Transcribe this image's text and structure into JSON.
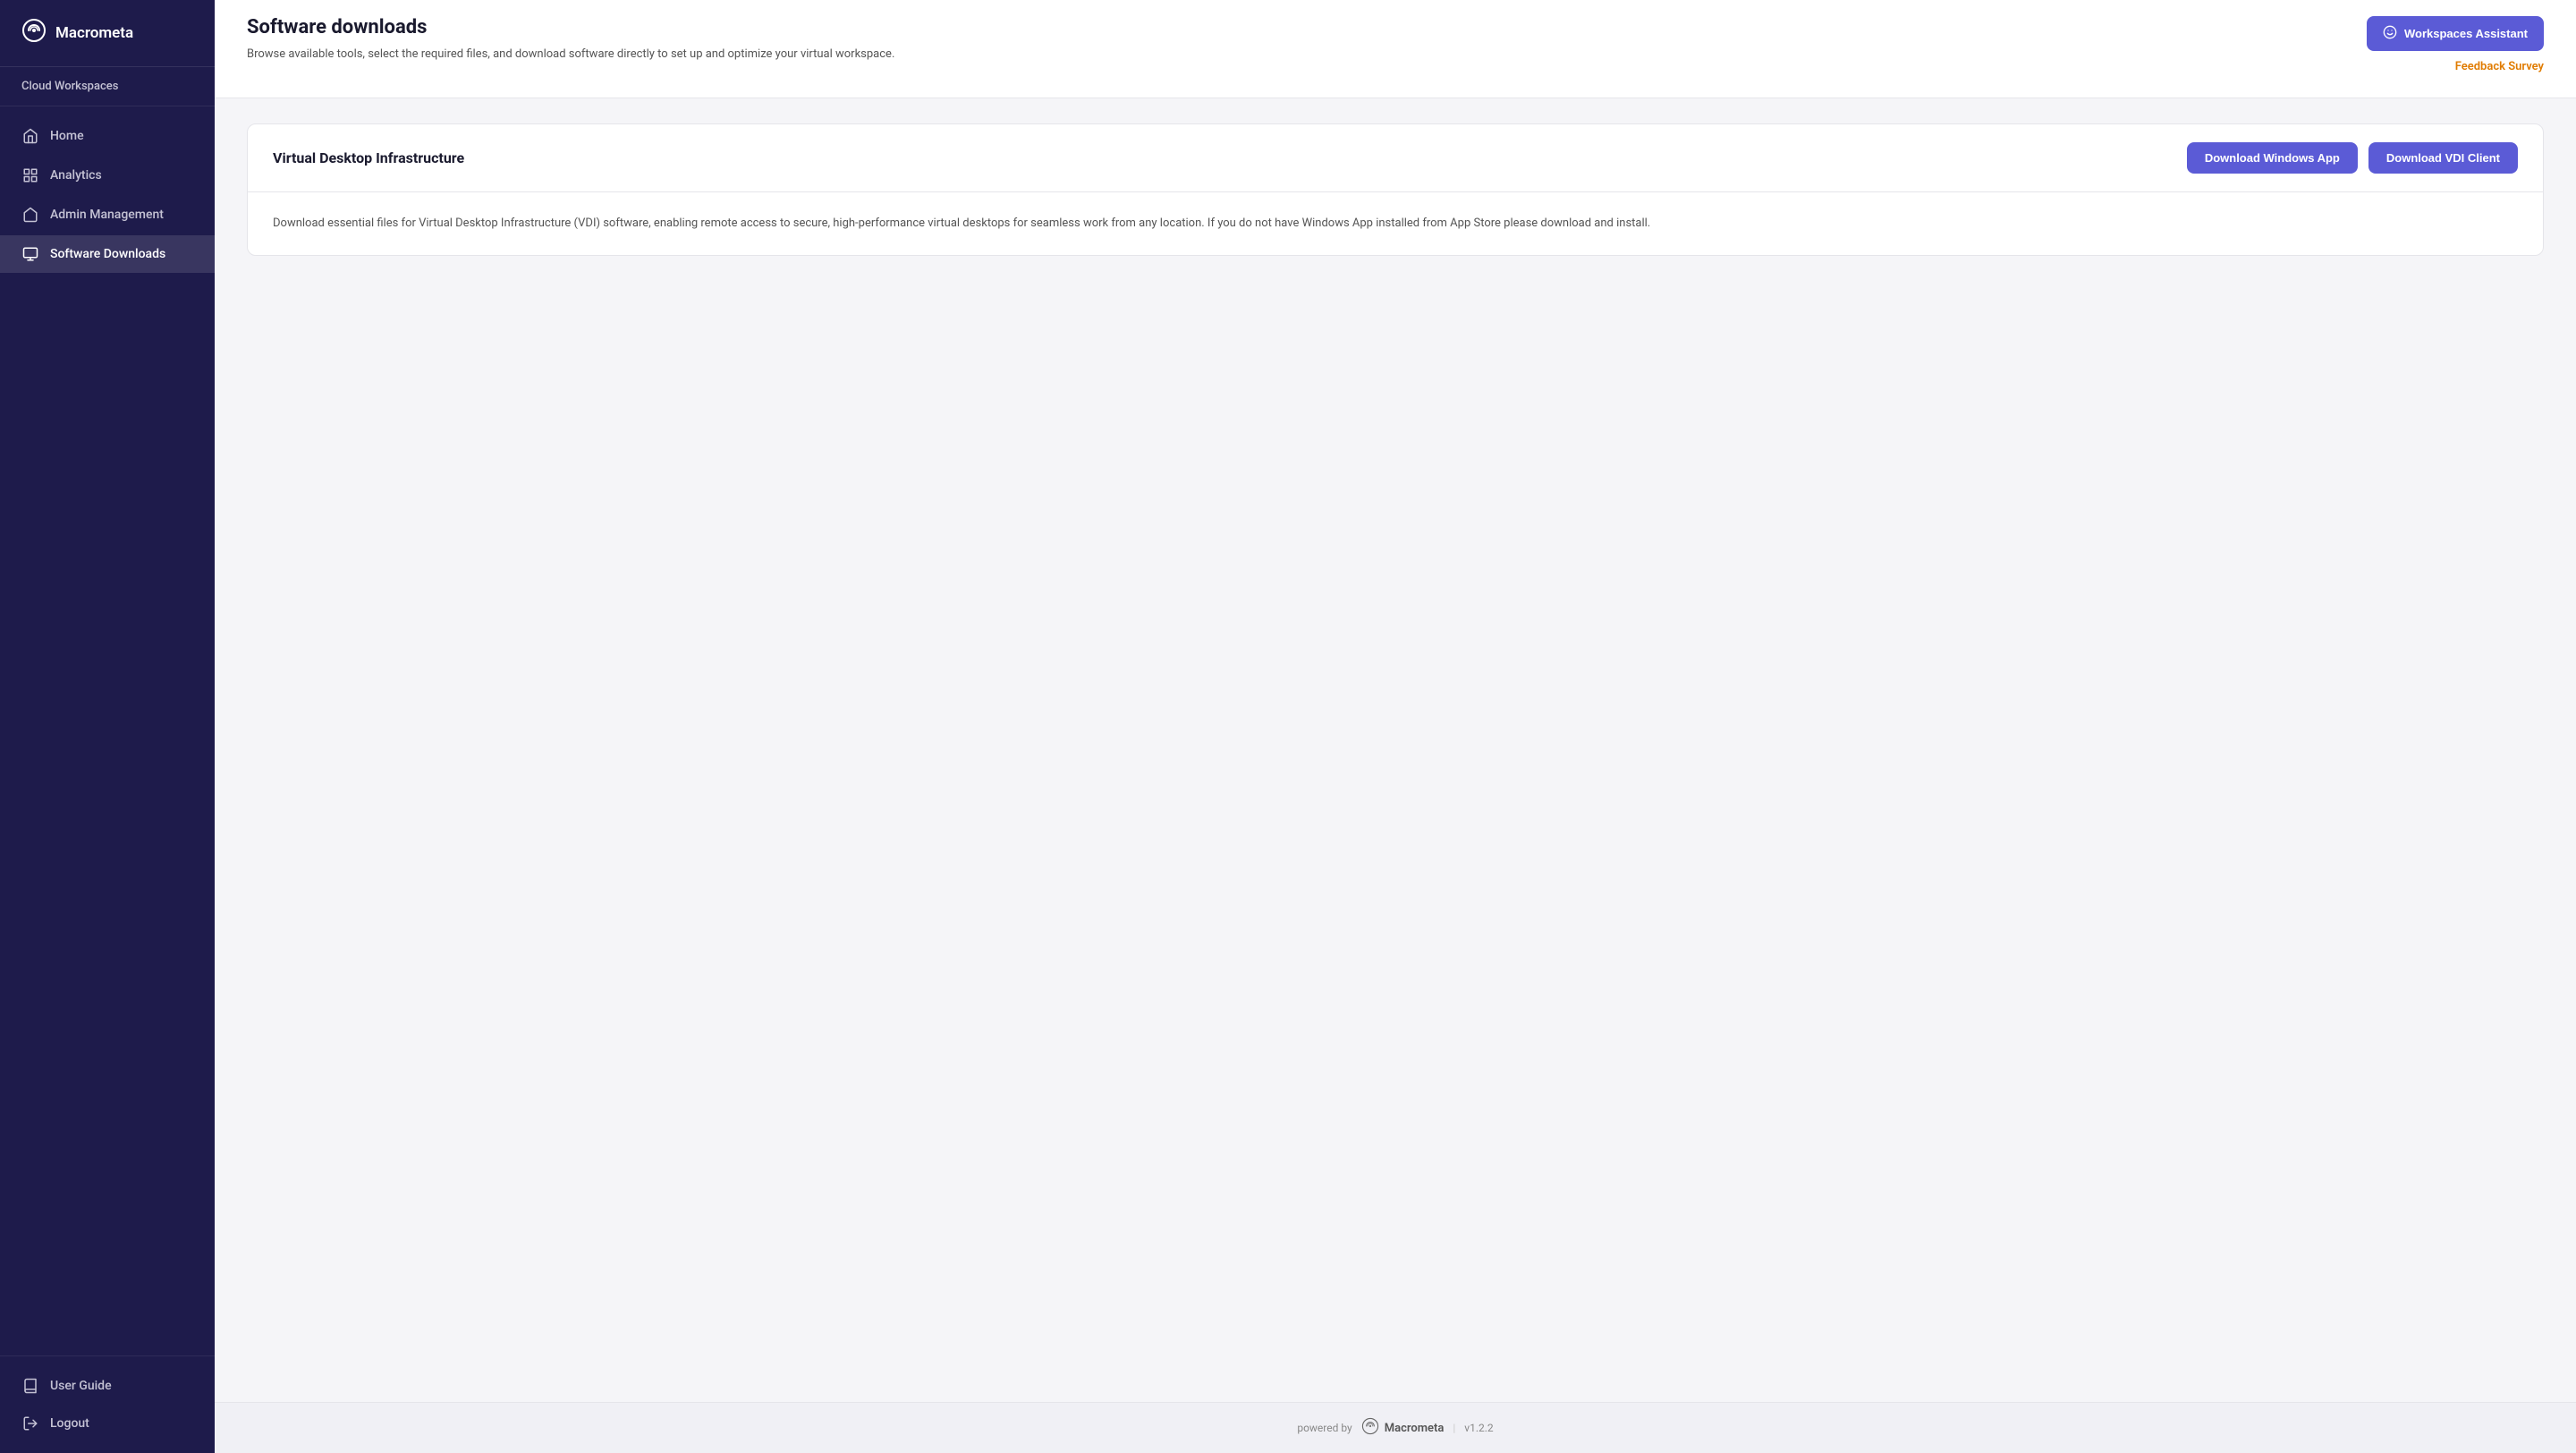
{
  "sidebar": {
    "logo_text": "Macrometa",
    "cloud_workspaces_label": "Cloud Workspaces",
    "nav_items": [
      {
        "id": "home",
        "label": "Home",
        "icon": "home-icon",
        "active": false
      },
      {
        "id": "analytics",
        "label": "Analytics",
        "icon": "analytics-icon",
        "active": false
      },
      {
        "id": "admin-management",
        "label": "Admin Management",
        "icon": "admin-icon",
        "active": false
      },
      {
        "id": "software-downloads",
        "label": "Software Downloads",
        "icon": "downloads-icon",
        "active": true
      }
    ],
    "bottom_items": [
      {
        "id": "user-guide",
        "label": "User Guide",
        "icon": "book-icon"
      },
      {
        "id": "logout",
        "label": "Logout",
        "icon": "logout-icon"
      }
    ]
  },
  "topbar": {
    "title": "Software downloads",
    "subtitle": "Browse available tools, select the required files, and download software directly to set up and optimize your virtual workspace.",
    "assistant_button": "Workspaces Assistant",
    "feedback_link": "Feedback Survey"
  },
  "cards": [
    {
      "id": "vdi",
      "title": "Virtual Desktop Infrastructure",
      "actions": [
        {
          "id": "download-windows",
          "label": "Download Windows App"
        },
        {
          "id": "download-vdi",
          "label": "Download VDI Client"
        }
      ],
      "description": "Download essential files for Virtual Desktop Infrastructure (VDI) software, enabling remote access to secure, high-performance virtual desktops for seamless work from any location. If you do not have Windows App installed from App Store please download and install."
    }
  ],
  "footer": {
    "powered_by": "powered by",
    "logo_text": "Macrometa",
    "version": "v1.2.2"
  }
}
